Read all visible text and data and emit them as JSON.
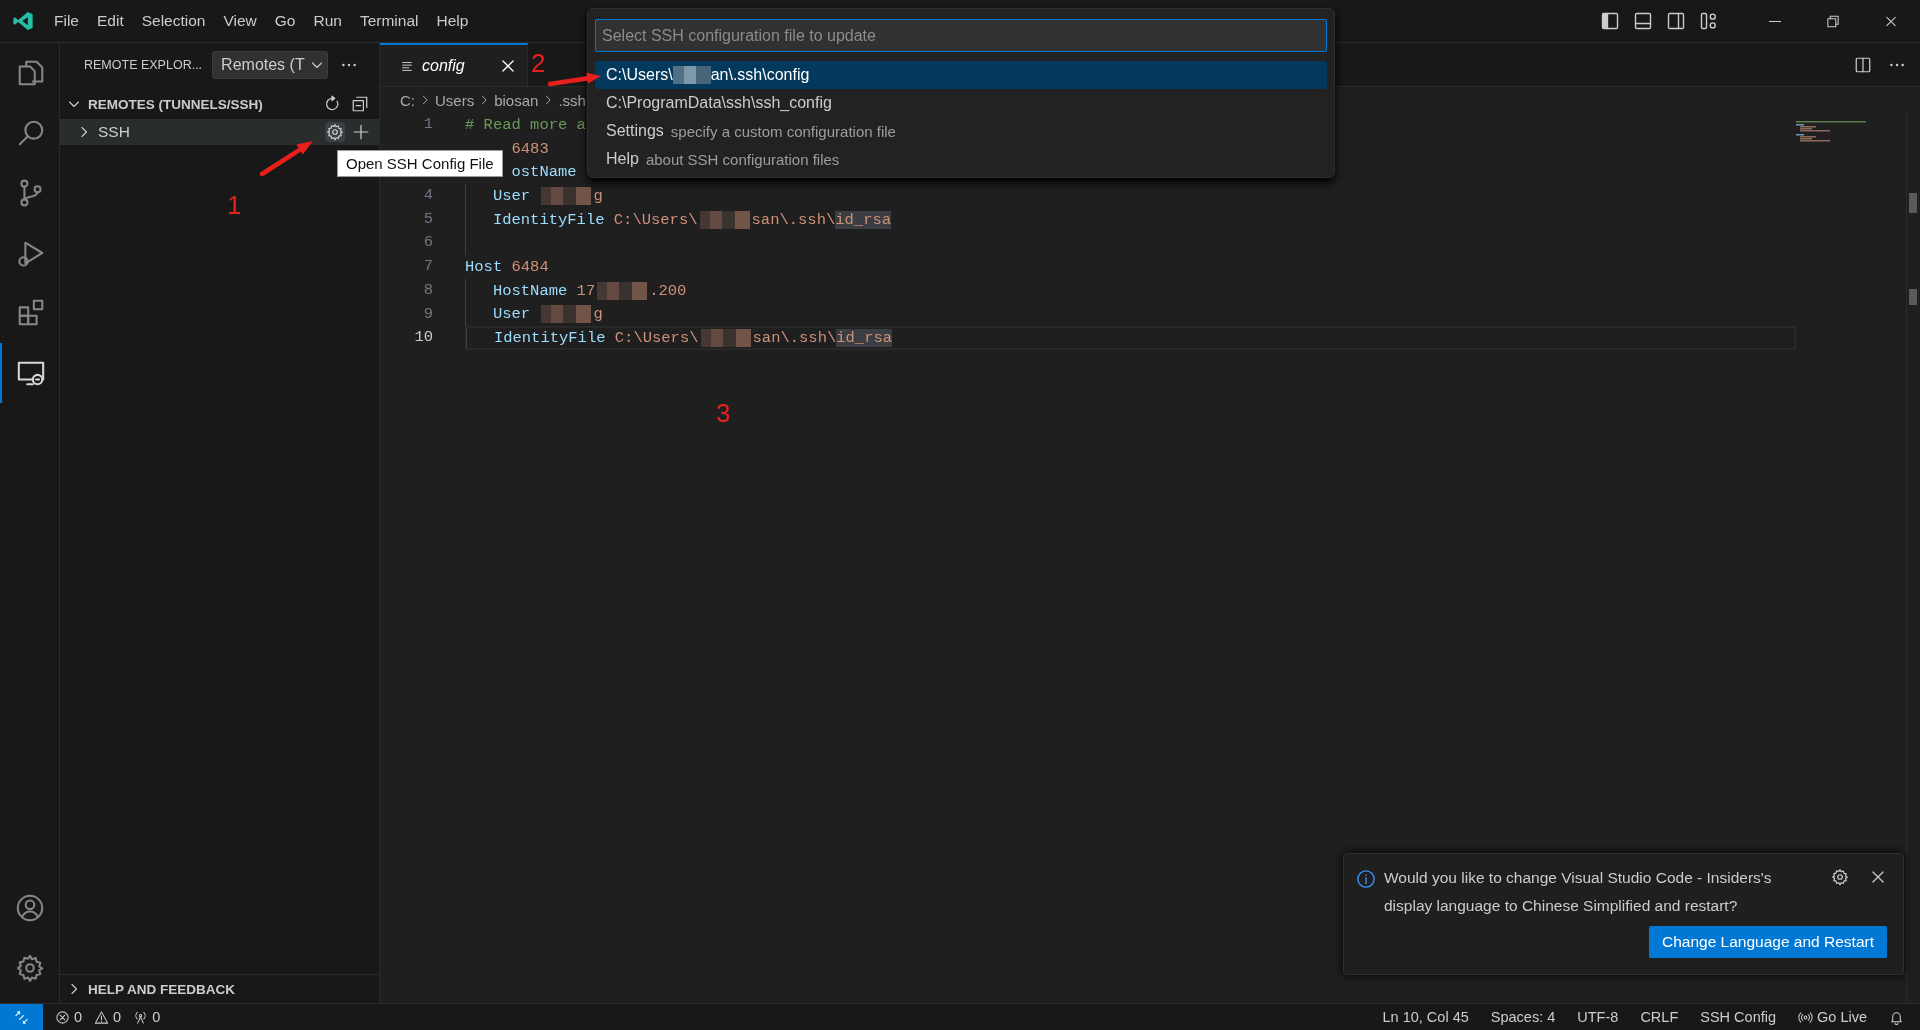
{
  "title_bar": {
    "menu": [
      "File",
      "Edit",
      "Selection",
      "View",
      "Go",
      "Run",
      "Terminal",
      "Help"
    ],
    "layout_toggles": [
      {
        "kind": "sidebar",
        "on": true
      },
      {
        "kind": "panel",
        "on": false
      },
      {
        "kind": "secondary",
        "on": false
      },
      {
        "kind": "customize"
      }
    ]
  },
  "activity_bar": {
    "items": [
      {
        "kind": "explorer",
        "selected": false
      },
      {
        "kind": "search",
        "selected": false
      },
      {
        "kind": "source-control",
        "selected": false
      },
      {
        "kind": "run-debug",
        "selected": false
      },
      {
        "kind": "extensions",
        "selected": false
      },
      {
        "kind": "remote",
        "selected": true
      }
    ],
    "bottom": [
      {
        "kind": "account"
      },
      {
        "kind": "settings"
      }
    ]
  },
  "sidebar": {
    "title": "REMOTE EXPLOR...",
    "dropdown": "Remotes (T",
    "sections": [
      {
        "title": "REMOTES (TUNNELS/SSH)",
        "expanded": true,
        "items": [
          {
            "label": "SSH",
            "expanded": false,
            "hovered": true
          }
        ]
      },
      {
        "title": "HELP AND FEEDBACK",
        "expanded": false
      }
    ]
  },
  "tooltip": {
    "text": "Open SSH Config File"
  },
  "editor": {
    "tabs": [
      {
        "label": "config",
        "selected": true,
        "preview": true
      }
    ],
    "breadcrumb": [
      "C:",
      "Users",
      "biosan",
      ".ssh"
    ],
    "lines": [
      {
        "number": "1",
        "current": false,
        "covered": false,
        "indented": false,
        "tokens": [
          {
            "text": "# Read more a",
            "kind": "comment"
          }
        ]
      },
      {
        "current": false,
        "covered": true,
        "indented": false,
        "tokens": [
          {
            "text": "6483",
            "kind": "value"
          }
        ]
      },
      {
        "current": false,
        "covered": true,
        "indented": false,
        "tokens": [
          {
            "text": "ostName",
            "kind": "keyword"
          }
        ]
      },
      {
        "number": "4",
        "current": false,
        "covered": false,
        "indented": true,
        "tokens": [
          {
            "text": "User",
            "kind": "keyword"
          },
          {
            "kind": "redacted"
          },
          {
            "text": "g",
            "kind": "value"
          }
        ]
      },
      {
        "number": "5",
        "current": false,
        "covered": false,
        "indented": true,
        "tokens": [
          {
            "text": "IdentityFile",
            "kind": "keyword"
          },
          {
            "text": "C:\\Users\\",
            "kind": "value"
          },
          {
            "kind": "redacted"
          },
          {
            "text": "san\\.ssh\\",
            "kind": "value"
          },
          {
            "text": "id_rsa",
            "kind": "highlight"
          }
        ]
      },
      {
        "number": "6",
        "current": false,
        "covered": false,
        "indented": true
      },
      {
        "number": "7",
        "current": false,
        "covered": false,
        "indented": false,
        "tokens": [
          {
            "text": "Host",
            "kind": "keyword"
          },
          {
            "text": "6484",
            "kind": "value"
          }
        ]
      },
      {
        "number": "8",
        "current": false,
        "covered": false,
        "indented": true,
        "tokens": [
          {
            "text": "HostName",
            "kind": "keyword"
          },
          {
            "text": "17",
            "kind": "value"
          },
          {
            "kind": "redacted"
          },
          {
            "text": ".200",
            "kind": "value"
          }
        ]
      },
      {
        "number": "9",
        "current": false,
        "covered": false,
        "indented": true,
        "tokens": [
          {
            "text": "User",
            "kind": "keyword"
          },
          {
            "kind": "redacted"
          },
          {
            "text": "g",
            "kind": "value"
          }
        ]
      },
      {
        "number": "10",
        "current": true,
        "covered": false,
        "indented": true,
        "tokens": [
          {
            "text": "IdentityFile",
            "kind": "keyword"
          },
          {
            "text": "C:\\Users\\",
            "kind": "value"
          },
          {
            "kind": "redacted"
          },
          {
            "text": "san\\.ssh\\",
            "kind": "value"
          },
          {
            "text": "id_rsa",
            "kind": "highlight"
          }
        ]
      }
    ]
  },
  "palette": {
    "placeholder": "Select SSH configuration file to update",
    "items": [
      {
        "parts": [
          {
            "text": "C:\\Users\\"
          },
          {
            "kind": "redacted"
          },
          {
            "text": "an\\.ssh\\config"
          }
        ],
        "selected": true
      },
      {
        "parts": [
          {
            "text": "C:\\ProgramData\\ssh\\ssh_config"
          }
        ],
        "selected": false
      },
      {
        "parts": [
          {
            "text": "Settings"
          }
        ],
        "description": "specify a custom configuration file",
        "selected": false
      },
      {
        "parts": [
          {
            "text": "Help"
          }
        ],
        "description": "about SSH configuration files",
        "selected": false
      }
    ]
  },
  "notification": {
    "message": "Would you like to change Visual Studio Code - Insiders's display language to Chinese Simplified and restart?",
    "button": "Change Language and Restart"
  },
  "annotations": [
    {
      "kind": "arrow"
    },
    {
      "kind": "arrow"
    },
    {
      "kind": "number",
      "text": "1"
    },
    {
      "kind": "number",
      "text": "2"
    },
    {
      "kind": "number",
      "text": "3"
    }
  ],
  "status_bar": {
    "left": [
      {
        "kind": "remote"
      },
      {
        "kind": "errors",
        "text": "0"
      },
      {
        "kind": "warnings",
        "text": "0"
      },
      {
        "kind": "ports",
        "text": "0"
      }
    ],
    "right": [
      {
        "kind": "text",
        "text": "Ln 10, Col 45"
      },
      {
        "kind": "text",
        "text": "Spaces: 4"
      },
      {
        "kind": "text",
        "text": "UTF-8"
      },
      {
        "kind": "text",
        "text": "CRLF"
      },
      {
        "kind": "text",
        "text": "SSH Config"
      },
      {
        "kind": "live",
        "text": "Go Live"
      },
      {
        "kind": "bell"
      }
    ]
  }
}
